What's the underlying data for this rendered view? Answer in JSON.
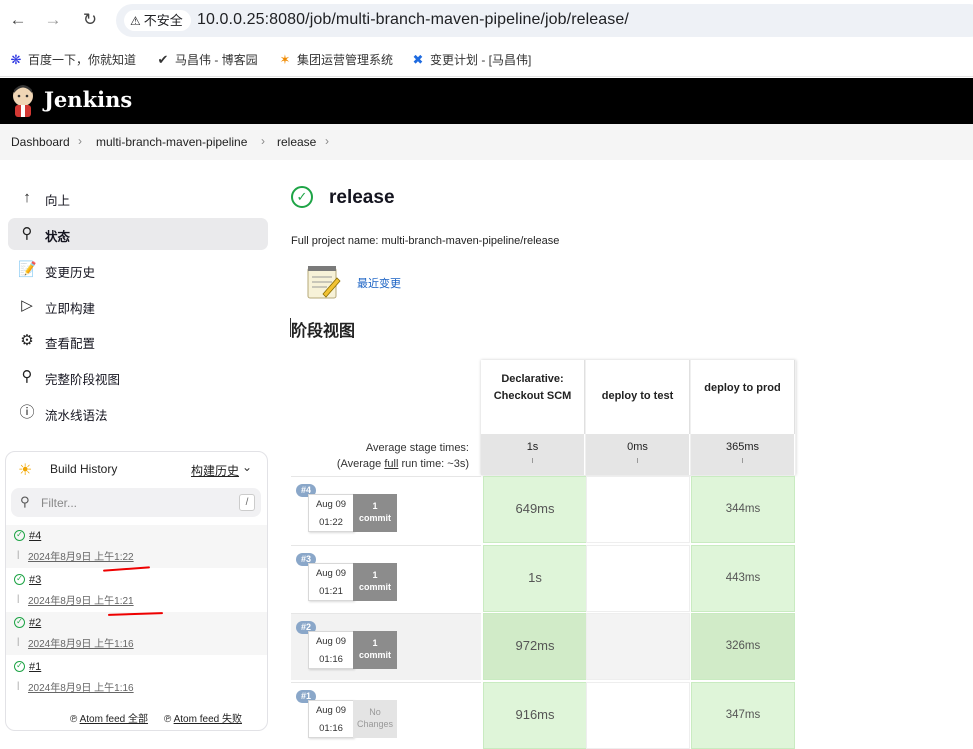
{
  "browser": {
    "security_label": "不安全",
    "url": "10.0.0.25:8080/job/multi-branch-maven-pipeline/job/release/",
    "bookmarks": [
      "百度一下，你就知道",
      "马昌伟 - 博客园",
      "集团运营管理系统",
      "变更计划 - [马昌伟]"
    ]
  },
  "header": {
    "brand": "Jenkins"
  },
  "breadcrumb": [
    "Dashboard",
    "multi-branch-maven-pipeline",
    "release"
  ],
  "sidebar": {
    "items": [
      {
        "label": "向上",
        "icon": "arrow-up-icon"
      },
      {
        "label": "状态",
        "icon": "search-icon",
        "active": true
      },
      {
        "label": "变更历史",
        "icon": "notepad-icon"
      },
      {
        "label": "立即构建",
        "icon": "play-icon"
      },
      {
        "label": "查看配置",
        "icon": "gear-icon"
      },
      {
        "label": "完整阶段视图",
        "icon": "search-icon"
      },
      {
        "label": "流水线语法",
        "icon": "help-icon"
      }
    ]
  },
  "build_history": {
    "title": "Build History",
    "trend_link": "构建历史",
    "filter_placeholder": "Filter...",
    "filter_key": "/",
    "builds": [
      {
        "number": "#4",
        "date": "2024年8月9日 上午1:22"
      },
      {
        "number": "#3",
        "date": "2024年8月9日 上午1:21"
      },
      {
        "number": "#2",
        "date": "2024年8月9日 上午1:16"
      },
      {
        "number": "#1",
        "date": "2024年8月9日 上午1:16"
      }
    ],
    "atom_all": "Atom feed 全部",
    "atom_failed": "Atom feed 失败"
  },
  "main": {
    "title": "release",
    "full_name": "Full project name: multi-branch-maven-pipeline/release",
    "recent_changes": "最近变更",
    "stage_view_heading": "阶段视图"
  },
  "stage_view": {
    "stages": [
      "Declarative: Checkout SCM",
      "deploy to test",
      "deploy to prod"
    ],
    "avg_label_1": "Average stage times:",
    "avg_label_2a": "(Average ",
    "avg_label_2b": "full",
    "avg_label_2c": " run time: ~3s)",
    "avg_times": [
      "1s",
      "0ms",
      "365ms"
    ],
    "runs": [
      {
        "badge": "#4",
        "month": "Aug 09",
        "time": "01:22",
        "commit_1": "1",
        "commit_2": "commit",
        "durations": [
          "649ms",
          "",
          "344ms"
        ]
      },
      {
        "badge": "#3",
        "month": "Aug 09",
        "time": "01:21",
        "commit_1": "1",
        "commit_2": "commit",
        "durations": [
          "1s",
          "",
          "443ms"
        ]
      },
      {
        "badge": "#2",
        "month": "Aug 09",
        "time": "01:16",
        "commit_1": "1",
        "commit_2": "commit",
        "durations": [
          "972ms",
          "",
          "326ms"
        ]
      },
      {
        "badge": "#1",
        "month": "Aug 09",
        "time": "01:16",
        "commit_1": "No",
        "commit_2": "Changes",
        "durations": [
          "916ms",
          "",
          "347ms"
        ]
      }
    ]
  },
  "colors": {
    "success_green": "#1ea446",
    "stage_ok_bg": "#dff5d9",
    "link_blue": "#1a62c4",
    "annotation_red": "#e00000"
  }
}
